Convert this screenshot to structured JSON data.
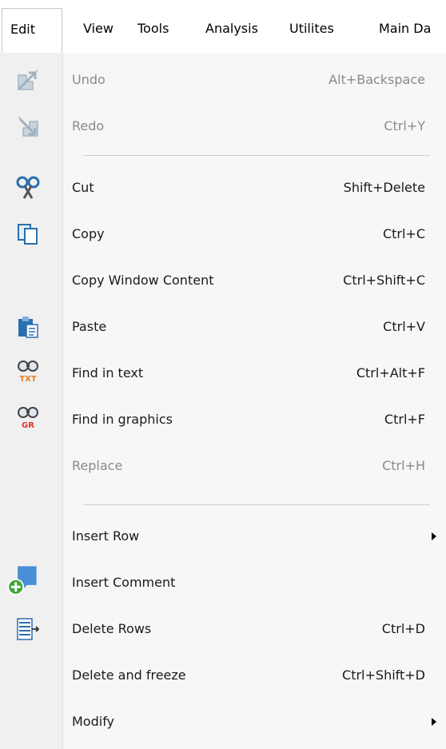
{
  "menubar": {
    "items": [
      {
        "label": "Edit",
        "active": true
      },
      {
        "label": "View"
      },
      {
        "label": "Tools"
      },
      {
        "label": "Analysis"
      },
      {
        "label": "Utilites"
      },
      {
        "label": "Main Da"
      }
    ]
  },
  "menu": {
    "items": [
      {
        "label": "Undo",
        "shortcut": "Alt+Backspace",
        "disabled": true,
        "icon": "undo-icon"
      },
      {
        "label": "Redo",
        "shortcut": "Ctrl+Y",
        "disabled": true,
        "icon": "redo-icon"
      },
      {
        "label": "Cut",
        "shortcut": "Shift+Delete",
        "icon": "scissors-icon"
      },
      {
        "label": "Copy",
        "shortcut": "Ctrl+C",
        "icon": "copy-icon"
      },
      {
        "label": "Copy Window Content",
        "shortcut": "Ctrl+Shift+C"
      },
      {
        "label": "Paste",
        "shortcut": "Ctrl+V",
        "icon": "paste-icon"
      },
      {
        "label": "Find in text",
        "shortcut": "Ctrl+Alt+F",
        "icon": "find-text-icon"
      },
      {
        "label": "Find in graphics",
        "shortcut": "Ctrl+F",
        "icon": "find-graphics-icon"
      },
      {
        "label": "Replace",
        "shortcut": "Ctrl+H",
        "disabled": true
      },
      {
        "label": "Insert Row",
        "submenu": true
      },
      {
        "label": "Insert Comment",
        "icon": "comment-add-icon"
      },
      {
        "label": "Delete Rows",
        "shortcut": "Ctrl+D",
        "icon": "delete-rows-icon"
      },
      {
        "label": "Delete and freeze",
        "shortcut": "Ctrl+Shift+D"
      },
      {
        "label": "Modify",
        "submenu": true
      }
    ],
    "icon_text": {
      "find_text": "TXT",
      "find_graphics": "GR"
    }
  },
  "colors": {
    "disabled": "#8a8a8a",
    "accent_red": "#e0312b",
    "accent_blue": "#4a8fd6",
    "accent_green": "#3fa535"
  }
}
